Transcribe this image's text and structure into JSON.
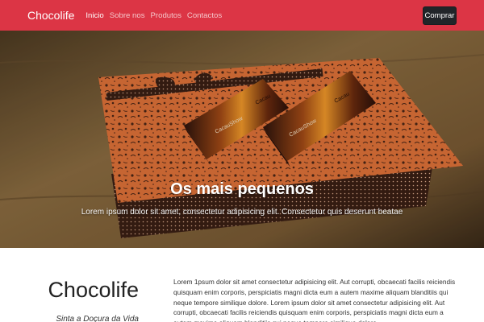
{
  "navbar": {
    "brand": "Chocolife",
    "links": [
      {
        "label": "Inicio",
        "active": true
      },
      {
        "label": "Sobre nos",
        "active": false
      },
      {
        "label": "Produtos",
        "active": false
      },
      {
        "label": "Contactos",
        "active": false
      }
    ],
    "button_label": "Comprar",
    "background_color": "#dc3545",
    "button_color": "#212529"
  },
  "hero": {
    "title": "Os mais pequenos",
    "text": "Lorem ipsum dolor sit amet, consectetur adipisicing elit. Consectetur quis deserunt beatae",
    "image_labels": {
      "bar_brand": "CacauShow",
      "bar_side_text": "Cacau"
    }
  },
  "about": {
    "title": "Chocolife",
    "subtitle": "Sinta a Doçura da Vida",
    "text": "Lorem 1psum dolor sit amet consectetur adipisicing elit. Aut corrupti, obcaecati facilis reiciendis quisquam enim corporis, perspiciatis magni dicta eum a autem maxime aliquam blanditiis qui neque tempore similique dolore. Lorem ipsum dolor sit amet consectetur adipisicing elit. Aut corrupti, obcaecati facilis reiciendis quisquam enim corporis, perspiciatis magni dicta eum a autem maxime aliquam blanditiis qui neque tempore similique dolore."
  }
}
